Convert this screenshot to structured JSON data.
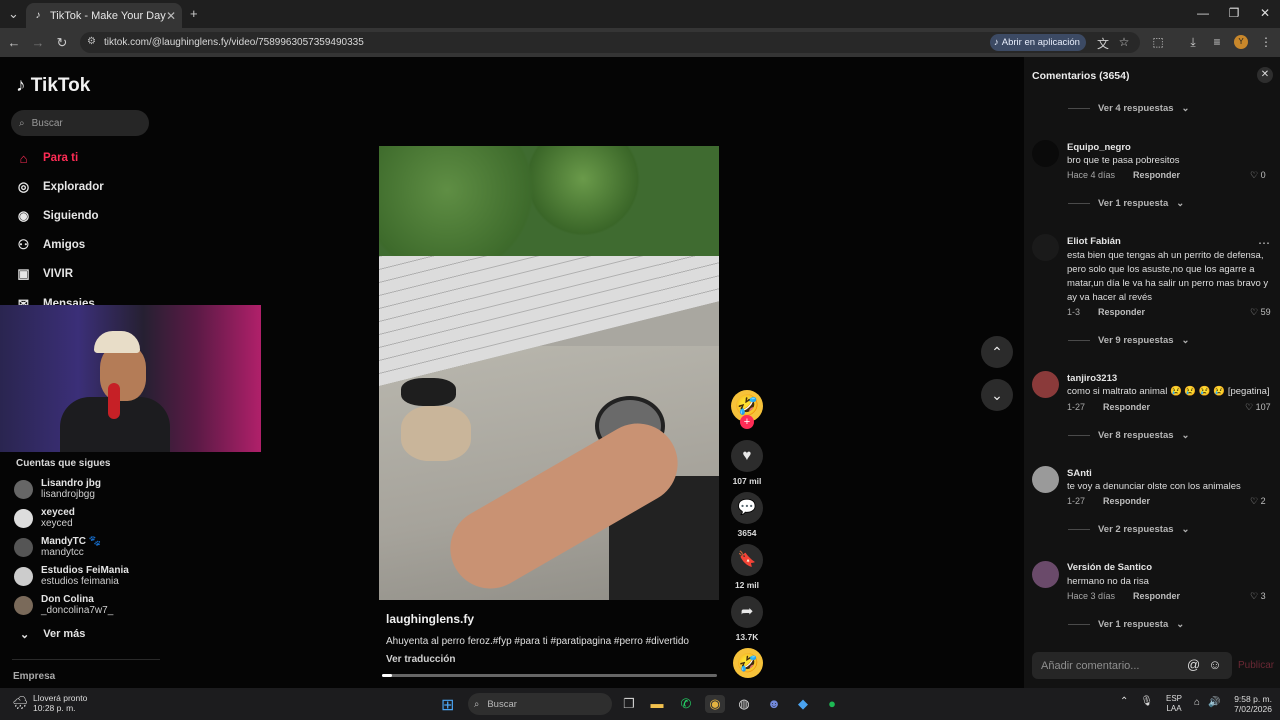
{
  "browser": {
    "tab_title": "TikTok - Make Your Day",
    "url": "tiktok.com/@laughinglens.fy/video/7589963057359490335",
    "open_in_app": "Abrir en aplicación",
    "profile_initial": "Y"
  },
  "sidebar": {
    "logo": "TikTok",
    "search_placeholder": "Buscar",
    "nav": [
      {
        "label": "Para ti",
        "icon": "home-icon",
        "active": true
      },
      {
        "label": "Explorador",
        "icon": "compass-icon"
      },
      {
        "label": "Siguiendo",
        "icon": "following-avatar-icon"
      },
      {
        "label": "Amigos",
        "icon": "friends-icon"
      },
      {
        "label": "VIVIR",
        "icon": "live-icon"
      },
      {
        "label": "Mensajes",
        "icon": "messages-icon"
      }
    ],
    "following_title": "Cuentas que sigues",
    "accounts": [
      {
        "name": "Lisandro jbg",
        "handle": "lisandrojbgg"
      },
      {
        "name": "xeyced",
        "handle": "xeyced"
      },
      {
        "name": "MandyTC 🐾",
        "handle": "mandytcc"
      },
      {
        "name": "Estudios FeiMania",
        "handle": "estudios feimania"
      },
      {
        "name": "Don Colina",
        "handle": "_doncolina7w7_"
      }
    ],
    "see_more": "Ver más",
    "company": "Empresa"
  },
  "video": {
    "creator": "laughinglens.fy",
    "description": "Ahuyenta al perro feroz.#fyp #para ti #paratipagina #perro #divertido",
    "translate": "Ver traducción",
    "progress": 0.03
  },
  "actions": {
    "likes": "107 mil",
    "comments": "3654",
    "saves": "12 mil",
    "shares": "13.7K"
  },
  "comments": {
    "title": "Comentarios",
    "count": "(3654)",
    "top_replies": "Ver 4 respuestas",
    "items": [
      {
        "user": "Equipo_negro",
        "text": "bro que te pasa pobresitos",
        "time": "Hace 4 días",
        "reply": "Responder",
        "likes": "0",
        "replies": "Ver 1 respuesta"
      },
      {
        "user": "Eliot Fabián",
        "text": "esta bien que tengas ah un perrito de defensa, pero solo que los asuste,no que los agarre a matar,un día le va ha salir un perro mas bravo y ay va hacer al revés",
        "time": "1-3",
        "reply": "Responder",
        "likes": "59",
        "replies": "Ver 9 respuestas"
      },
      {
        "user": "tanjiro3213",
        "text": "como si maltrato animal 😢 😢 😢 😢 [pegatina]",
        "time": "1-27",
        "reply": "Responder",
        "likes": "107",
        "replies": "Ver 8 respuestas"
      },
      {
        "user": "SAnti",
        "text": "te voy a denunciar olste con los animales",
        "time": "1-27",
        "reply": "Responder",
        "likes": "2",
        "replies": "Ver 2 respuestas"
      },
      {
        "user": "Versión de Santico",
        "text": "hermano no da risa",
        "time": "Hace 3 días",
        "reply": "Responder",
        "likes": "3",
        "replies": "Ver 1 respuesta"
      }
    ],
    "input_placeholder": "Añadir comentario...",
    "post": "Publicar"
  },
  "taskbar": {
    "weather_line1": "Lloverá pronto",
    "weather_line2": "10:28 p. m.",
    "search": "Buscar",
    "lang_line1": "ESP",
    "lang_line2": "LAA",
    "time": "9:58 p. m.",
    "date": "7/02/2026"
  },
  "colors": {
    "accent": "#fe2c55",
    "panel": "#121212"
  }
}
